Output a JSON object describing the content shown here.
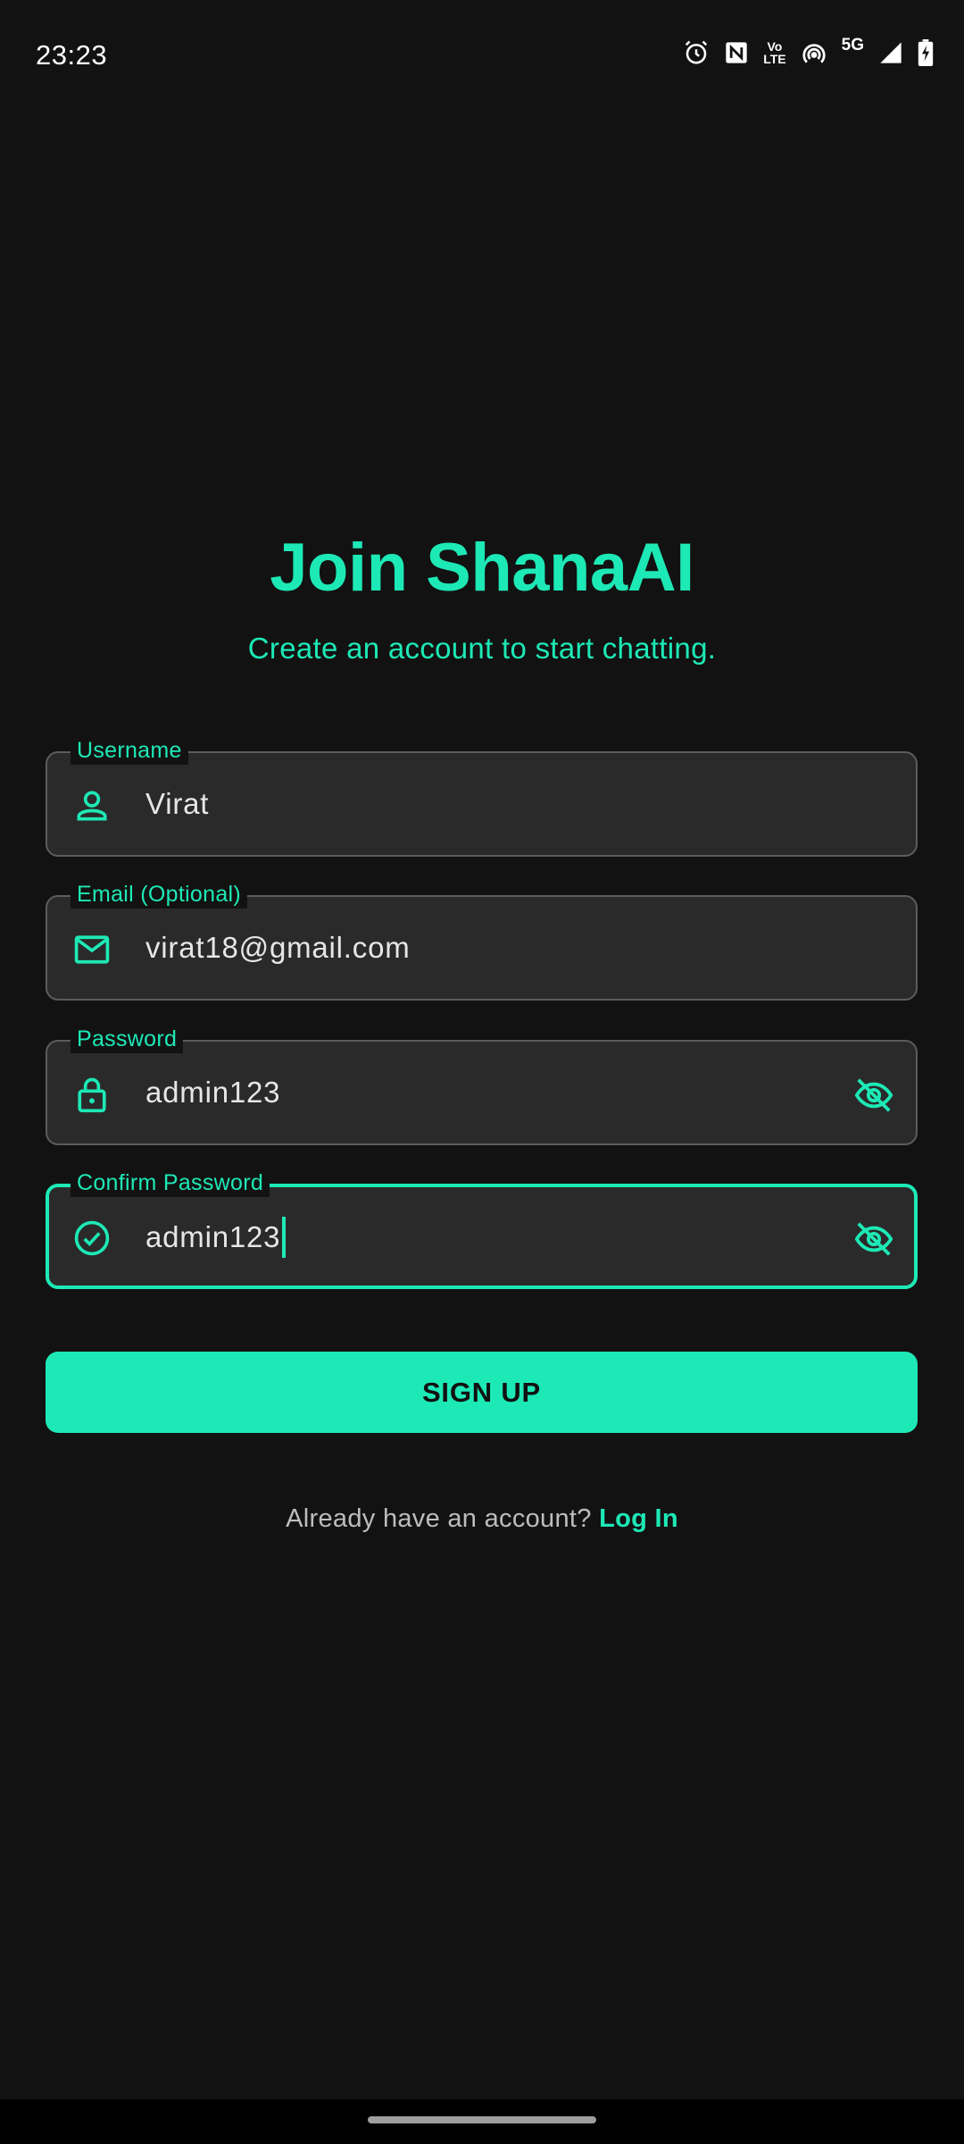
{
  "status_bar": {
    "time": "23:23",
    "lte_label_top": "Vo",
    "lte_label_bottom": "LTE",
    "network": "5G"
  },
  "header": {
    "title": "Join ShanaAI",
    "subtitle": "Create an account to start chatting."
  },
  "form": {
    "username": {
      "label": "Username",
      "value": "Virat",
      "icon": "person-icon"
    },
    "email": {
      "label": "Email (Optional)",
      "value": "virat18@gmail.com",
      "icon": "mail-icon"
    },
    "password": {
      "label": "Password",
      "value": "admin123",
      "icon": "lock-icon",
      "visibility_icon": "eye-off-icon"
    },
    "confirm_password": {
      "label": "Confirm Password",
      "value": "admin123",
      "icon": "check-circle-icon",
      "visibility_icon": "eye-off-icon",
      "focused": true
    }
  },
  "signup_button": {
    "label": "SIGN UP"
  },
  "login_prompt": {
    "text": "Already have an account? ",
    "link": "Log In"
  },
  "colors": {
    "accent": "#1de9b6",
    "background": "#121212",
    "field_background": "#2a2a2a",
    "field_border": "#5c5c5c"
  }
}
